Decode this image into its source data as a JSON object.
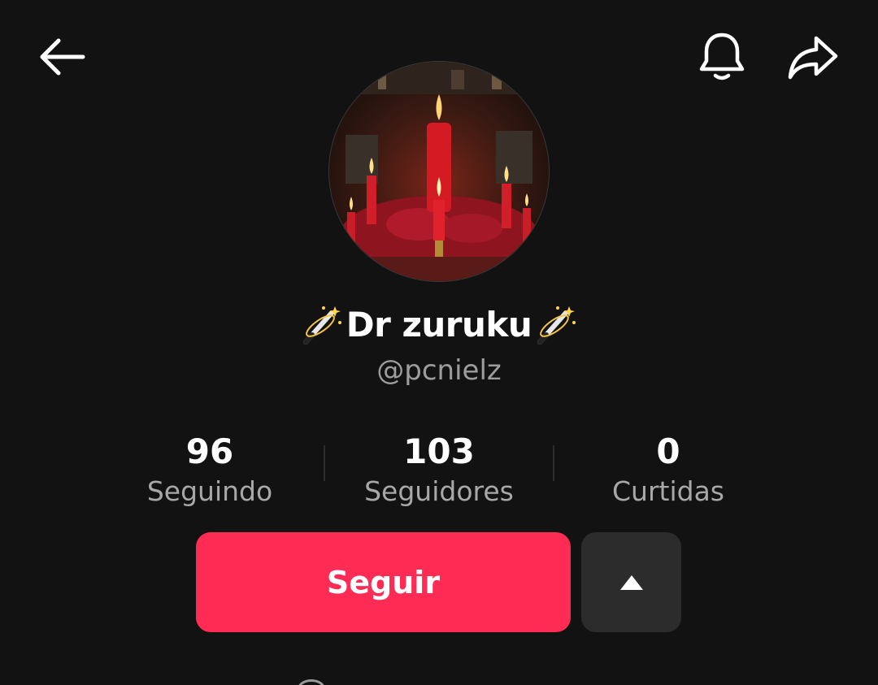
{
  "header": {
    "back_icon": "arrow-left-icon",
    "notification_icon": "bell-icon",
    "share_icon": "share-arrow-icon"
  },
  "profile": {
    "avatar_icon": "profile-photo-candles",
    "display_name": "Dr zuruku",
    "name_emoji": "magic-wand-emoji",
    "username": "@pcnielz"
  },
  "stats": [
    {
      "value": "96",
      "label": "Seguindo"
    },
    {
      "value": "103",
      "label": "Seguidores"
    },
    {
      "value": "0",
      "label": "Curtidas"
    }
  ],
  "actions": {
    "follow_label": "Seguir",
    "suggestions_icon": "triangle-up-icon"
  },
  "colors": {
    "background": "#121212",
    "accent": "#fe2c55",
    "secondary_button": "#2c2c2c",
    "muted_text": "#9d9d9d"
  }
}
